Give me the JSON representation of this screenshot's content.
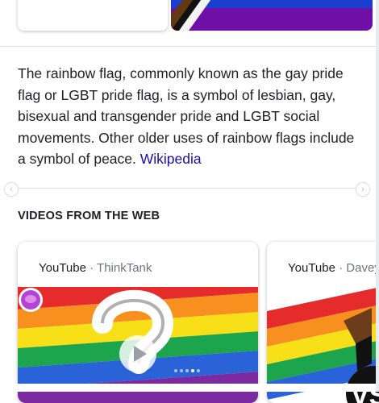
{
  "knowledge_panel": {
    "description": "The rainbow flag, commonly known as the gay pride flag or LGBT pride flag, is a symbol of lesbian, gay, bisexual and transgender pride and LGBT social movements. Other older uses of rainbow flags include a symbol of peace.",
    "source_link": "Wikipedia"
  },
  "carousel": {
    "left_arrow_icon": "chevron-left-icon",
    "right_arrow_icon": "chevron-right-icon"
  },
  "videos_section": {
    "title": "VIDEOS FROM THE WEB",
    "videos": [
      {
        "platform": "YouTube",
        "separator": "·",
        "channel": "ThinkTank"
      },
      {
        "platform": "YouTube",
        "separator": "·",
        "channel": "Davey"
      }
    ]
  },
  "colors": {
    "link": "#1a0dab",
    "rainbow": [
      "#e40303",
      "#ff8c00",
      "#ffed00",
      "#008026",
      "#004dff",
      "#750787"
    ]
  }
}
